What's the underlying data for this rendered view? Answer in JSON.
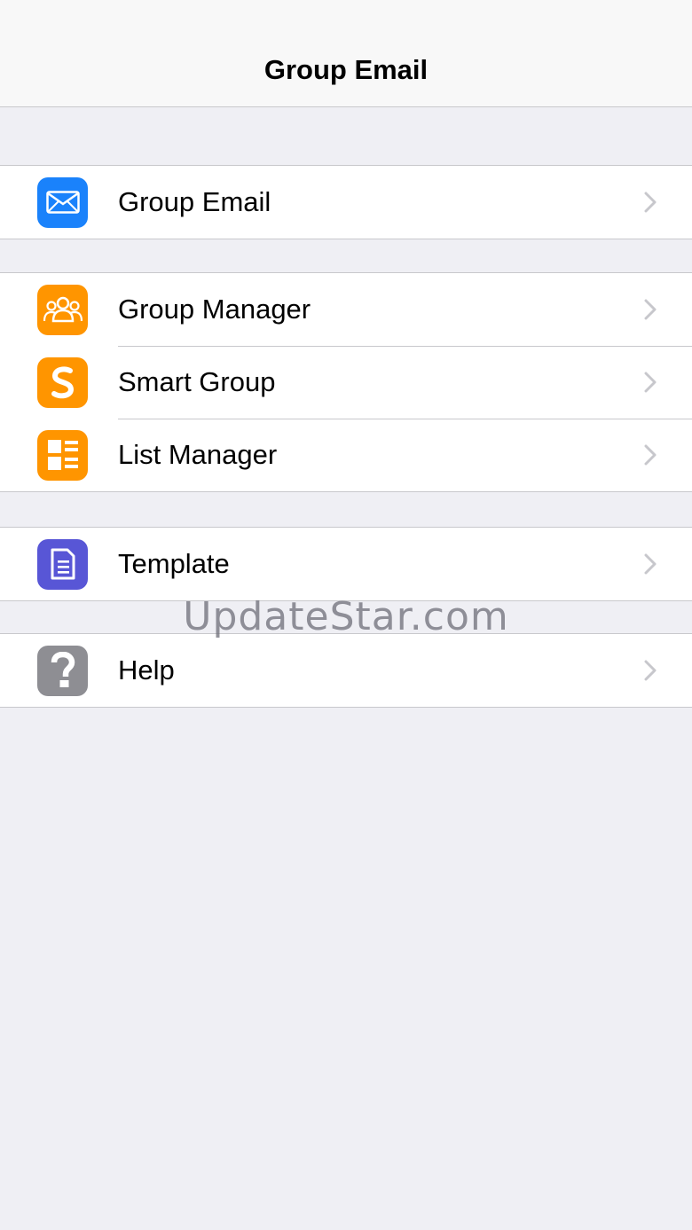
{
  "navbar": {
    "title": "Group Email"
  },
  "sections": [
    {
      "items": [
        {
          "label": "Group Email",
          "icon": "mail-icon",
          "color": "#1a82fb"
        }
      ]
    },
    {
      "items": [
        {
          "label": "Group Manager",
          "icon": "people-icon",
          "color": "#ff9500"
        },
        {
          "label": "Smart Group",
          "icon": "smart-s-icon",
          "color": "#ff9500"
        },
        {
          "label": "List Manager",
          "icon": "list-icon",
          "color": "#ff9500"
        }
      ]
    },
    {
      "items": [
        {
          "label": "Template",
          "icon": "document-icon",
          "color": "#5856d6"
        }
      ]
    },
    {
      "items": [
        {
          "label": "Help",
          "icon": "question-icon",
          "color": "#8e8e93"
        }
      ]
    }
  ],
  "watermark": "UpdateStar.com"
}
